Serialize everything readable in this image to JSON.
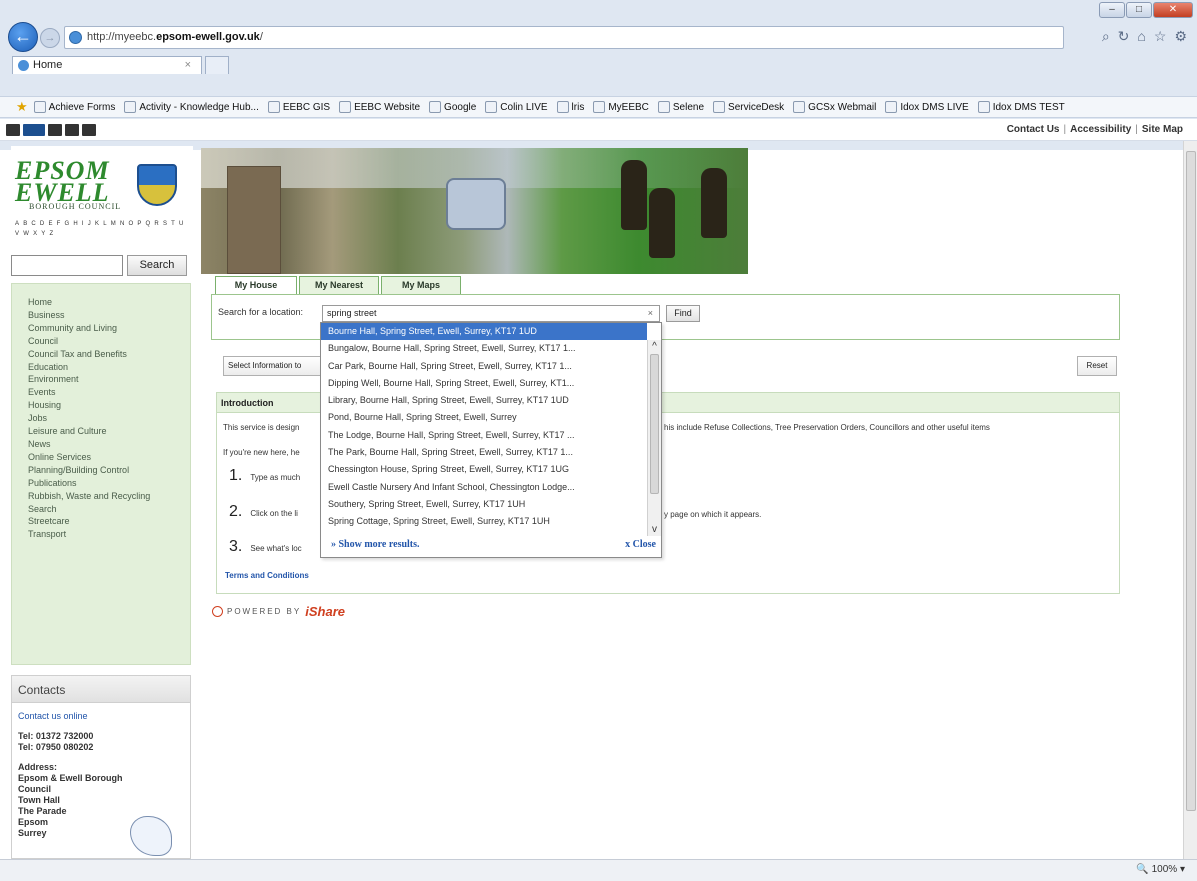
{
  "browser": {
    "address_prefix": "http://myeebc.",
    "address_host": "epsom-ewell.gov.uk",
    "address_suffix": "/",
    "tab_title": "Home",
    "tab_close": "×",
    "favorites": [
      "Achieve Forms",
      "Activity - Knowledge Hub...",
      "EEBC GIS",
      "EEBC Website",
      "Google",
      "Colin LIVE",
      "lris",
      "MyEEBC",
      "Selene",
      "ServiceDesk",
      "GCSx Webmail",
      "Idox DMS LIVE",
      "Idox DMS TEST"
    ],
    "zoom": "100%"
  },
  "header_links": [
    "Contact Us",
    "Accessibility",
    "Site Map"
  ],
  "logo": {
    "line1": "EPSOM",
    "line2": "EWELL",
    "sub": "BOROUGH COUNCIL",
    "alphabet": "ABCDEFGHIJKLMNOPQRSTUVWXYZ"
  },
  "site_search": {
    "button": "Search",
    "value": ""
  },
  "left_nav": [
    "Home",
    "Business",
    "Community and Living",
    "Council",
    "Council Tax and Benefits",
    "Education",
    "Environment",
    "Events",
    "Housing",
    "Jobs",
    "Leisure and Culture",
    "News",
    "Online Services",
    "Planning/Building Control",
    "Publications",
    "Rubbish, Waste and Recycling",
    "Search",
    "Streetcare",
    "Transport"
  ],
  "contacts": {
    "title": "Contacts",
    "online": "Contact us online",
    "tel1": "Tel:  01372 732000",
    "tel2": "Tel:  07950 080202",
    "address_label": "Address:",
    "address": [
      "Epsom & Ewell Borough",
      "Council",
      "Town Hall",
      "The Parade",
      "Epsom",
      "Surrey"
    ]
  },
  "tabs": [
    "My House",
    "My Nearest",
    "My Maps"
  ],
  "location_search": {
    "label": "Search for a location:",
    "value": "spring street",
    "clear": "×",
    "find": "Find"
  },
  "select_info": "Select Information to",
  "reset": "Reset",
  "intro": {
    "title": "Introduction",
    "line1_start": "This service is design",
    "line1_end": "his include Refuse Collections, Tree Preservation Orders, Councillors and other useful items",
    "line2": "If you're new here, he",
    "steps": [
      {
        "num": "1.",
        "text": "Type as much"
      },
      {
        "num": "2.",
        "text": "Click on the li",
        "tail": "y page on which it appears."
      },
      {
        "num": "3.",
        "text": "See what's loc"
      }
    ],
    "terms": "Terms and Conditions"
  },
  "powered": {
    "by": "POWERED BY",
    "brand": "iShare"
  },
  "dropdown": {
    "items": [
      "Bourne Hall, Spring Street, Ewell, Surrey, KT17 1UD",
      "Bungalow, Bourne Hall, Spring Street, Ewell, Surrey, KT17 1...",
      "Car Park, Bourne Hall, Spring Street, Ewell, Surrey, KT17 1...",
      "Dipping Well, Bourne Hall, Spring Street, Ewell, Surrey, KT1...",
      "Library, Bourne Hall, Spring Street, Ewell, Surrey, KT17 1UD",
      "Pond, Bourne Hall, Spring Street, Ewell, Surrey",
      "The Lodge, Bourne Hall, Spring Street, Ewell, Surrey, KT17 ...",
      "The Park, Bourne Hall, Spring Street, Ewell, Surrey, KT17 1...",
      "Chessington House, Spring Street, Ewell, Surrey, KT17 1UG",
      "Ewell Castle Nursery And Infant School, Chessington Lodge...",
      "Southery, Spring Street, Ewell, Surrey, KT17 1UH",
      "Spring Cottage, Spring Street, Ewell, Surrey, KT17 1UH"
    ],
    "selected_index": 0,
    "show_more": "» Show more results.",
    "close": "x Close"
  }
}
